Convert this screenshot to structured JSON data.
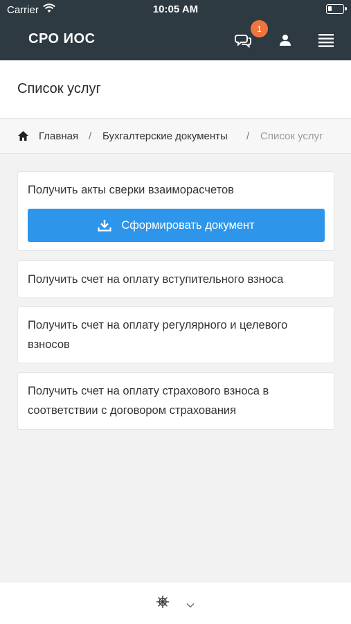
{
  "status_bar": {
    "carrier": "Carrier",
    "time": "10:05 AM",
    "icons": [
      "wifi-icon",
      "battery-icon"
    ]
  },
  "navbar": {
    "brand": "СРО ИОС",
    "badge_count": "1",
    "background_color": "#2d3a42",
    "badge_color": "#f0743e",
    "icons": [
      "chat-icon",
      "user-icon",
      "menu-icon"
    ]
  },
  "page": {
    "title": "Список услуг"
  },
  "breadcrumb": {
    "home": "Главная",
    "sep1": "/",
    "section": "Бухгалтерские документы",
    "sep2": "/",
    "current": "Список услуг"
  },
  "services": {
    "item1": {
      "title": "Получить акты сверки взаиморасчетов",
      "button_label": "Сформировать документ",
      "button_color": "#2d96ea",
      "button_icon": "download-icon"
    },
    "item2": {
      "title": "Получить счет на оплату вступительного взноса"
    },
    "item3": {
      "title": "Получить счет на оплату регулярного и целевого взносов"
    },
    "item4": {
      "title": "Получить счет на оплату страхового взноса в соответствии с договором страхования"
    }
  },
  "bottom_bar": {
    "icons": [
      "ship-wheel-icon",
      "chevron-down-icon"
    ]
  }
}
